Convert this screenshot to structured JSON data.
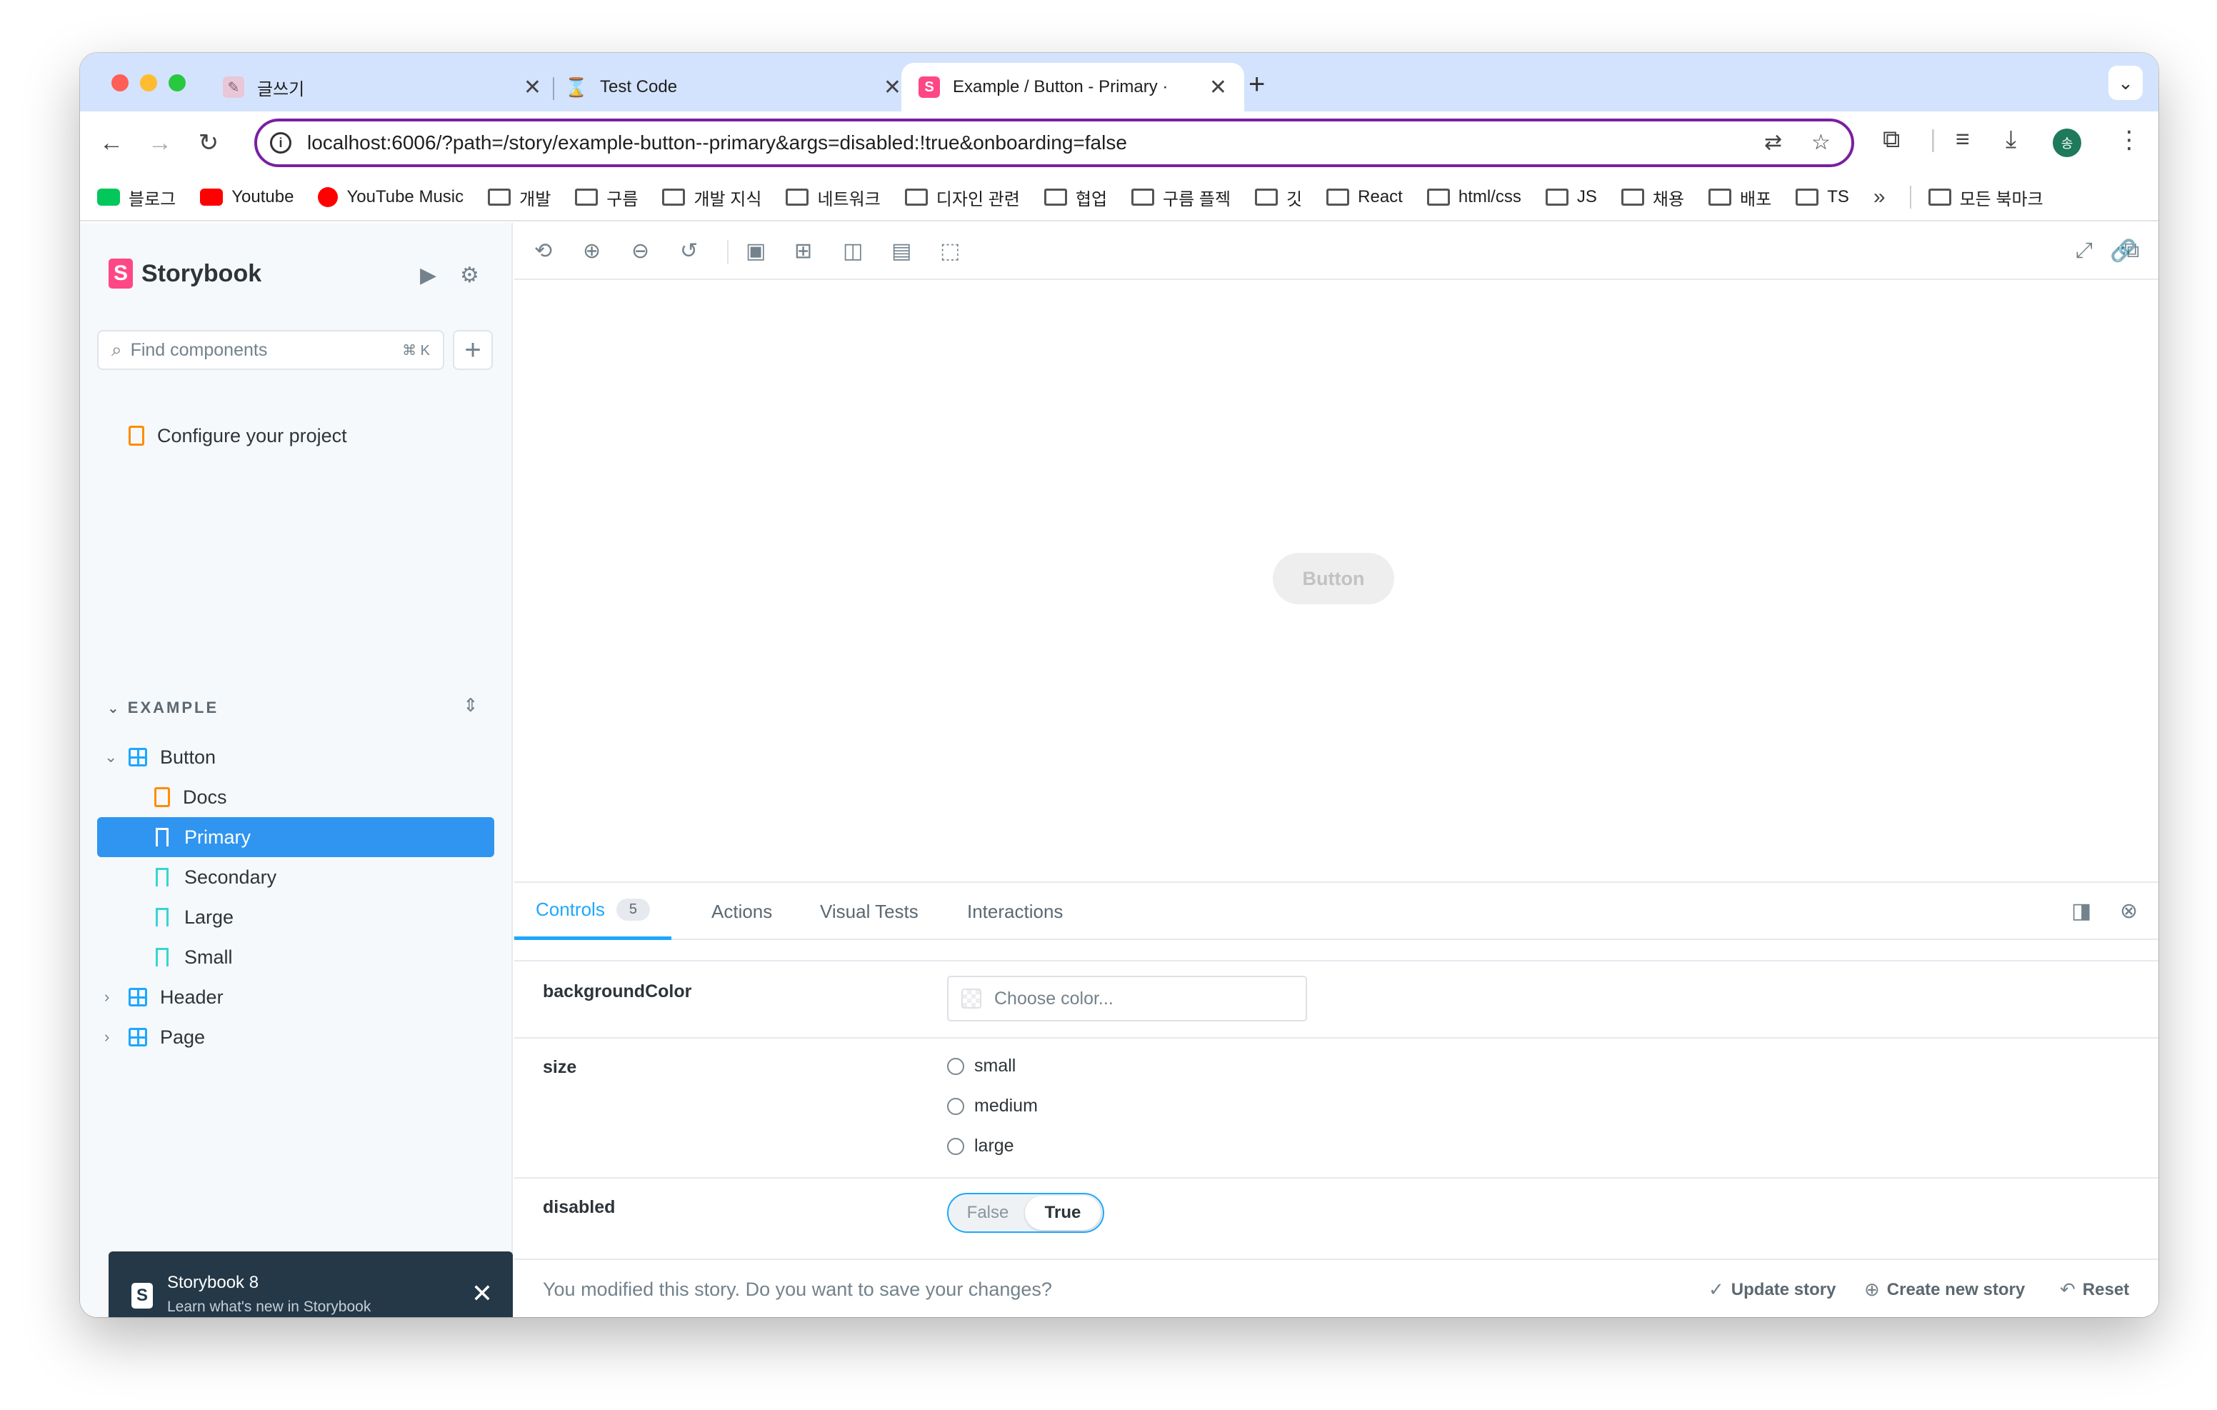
{
  "browser": {
    "tabs": [
      {
        "title": "글쓰기",
        "icon": "blog-favicon"
      },
      {
        "title": "Test Code",
        "icon": "hourglass-favicon"
      },
      {
        "title": "Example / Button - Primary ·",
        "icon": "storybook-favicon"
      }
    ],
    "tab_close": "✕",
    "new_tab": "+",
    "url": "localhost:6006/?path=/story/example-button--primary&args=disabled:!true&onboarding=false",
    "avatar_initial": "송",
    "bookmarks": [
      "블로그",
      "Youtube",
      "YouTube Music",
      "개발",
      "구름",
      "개발 지식",
      "네트워크",
      "디자인 관련",
      "협업",
      "구름 플젝",
      "깃",
      "React",
      "html/css",
      "JS",
      "채용",
      "배포",
      "TS"
    ],
    "bookmarks_more": "»",
    "all_bookmarks": "모든 북마크"
  },
  "sidebar": {
    "brand": "Storybook",
    "brand_mark": "S",
    "search_placeholder": "Find components",
    "search_shortcut": "⌘ K",
    "add_label": "+",
    "configure": "Configure your project",
    "group": "EXAMPLE",
    "tree": {
      "button": "Button",
      "docs": "Docs",
      "primary": "Primary",
      "secondary": "Secondary",
      "large": "Large",
      "small": "Small",
      "header": "Header",
      "page": "Page"
    }
  },
  "toast": {
    "title": "Storybook 8",
    "subtitle": "Learn what's new in Storybook"
  },
  "canvas": {
    "button_label": "Button"
  },
  "panel": {
    "tabs": {
      "controls": "Controls",
      "controls_count": "5",
      "actions": "Actions",
      "visual_tests": "Visual Tests",
      "interactions": "Interactions"
    },
    "controls": {
      "background_color": {
        "name": "backgroundColor",
        "placeholder": "Choose color..."
      },
      "size": {
        "name": "size",
        "options": [
          "small",
          "medium",
          "large"
        ]
      },
      "disabled": {
        "name": "disabled",
        "off": "False",
        "on": "True",
        "value": true
      }
    },
    "footer": {
      "message": "You modified this story. Do you want to save your changes?",
      "update": "Update story",
      "create": "Create new story",
      "reset": "Reset"
    }
  },
  "colors": {
    "accent": "#1ea7fd",
    "storybook_pink": "#ff4785",
    "selected": "#2f95f0",
    "omnibox_border": "#7a1fa2"
  }
}
